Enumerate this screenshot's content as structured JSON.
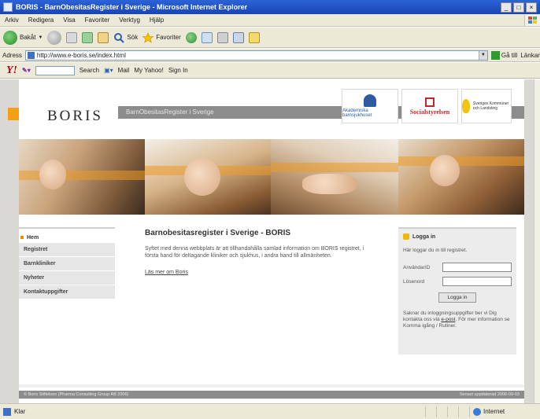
{
  "window": {
    "title": "BORIS - BarnObesitasRegister i Sverige - Microsoft Internet Explorer",
    "controls": [
      "_",
      "□",
      "×"
    ]
  },
  "menubar": {
    "items": [
      "Arkiv",
      "Redigera",
      "Visa",
      "Favoriter",
      "Verktyg",
      "Hjälp"
    ]
  },
  "toolbar": {
    "back_label": "Bakåt",
    "search_label": "Sök",
    "favorites_label": "Favoriter"
  },
  "addressbar": {
    "label": "Adress",
    "url": "http://www.e-boris.se/index.html",
    "go_label": "Gå till",
    "links_label": "Länkar"
  },
  "yahoobar": {
    "search_label": "Search",
    "mail_label": "Mail",
    "my_yahoo_label": "My Yahoo!",
    "signin_label": "Sign In"
  },
  "site": {
    "logo": "BORIS",
    "tagline": "BarnObesitasRegister i Sverige",
    "partners": [
      {
        "label": "Akademiska barnsjukhuset"
      },
      {
        "label": "Socialstyrelsen"
      },
      {
        "label": "Sveriges Kommuner och Landsting"
      }
    ]
  },
  "nav": {
    "home": "Hem",
    "items": [
      "Registret",
      "Barnkliniker",
      "Nyheter",
      "Kontaktuppgifter"
    ]
  },
  "main": {
    "heading": "Barnobesitasregister i Sverige - BORIS",
    "body": "Syftet med denna webbplats är att tillhandahålla samlad information om BORIS registret, i första hand för deltagande kliniker och sjukhus, i andra hand till allmänheten.",
    "link": "Läs mer om Boris"
  },
  "login": {
    "title": "Logga in",
    "intro": "Här loggar du in till registret.",
    "user_label": "AnvändarID",
    "password_label": "Lösenord",
    "button": "Logga in",
    "help_before": "Saknar du inloggningsuppgifter ber vi Dig kontakta oss via ",
    "help_link": "e-post",
    "help_after": ". För mer information se Komma igång / Rutiner."
  },
  "footer": {
    "left": "© Boris Stiftelsen (Pharma Consulting Group AB 2006)",
    "right": "Senast uppdaterad 2006-09-03"
  },
  "status": {
    "left": "Klar",
    "zone": "Internet"
  }
}
